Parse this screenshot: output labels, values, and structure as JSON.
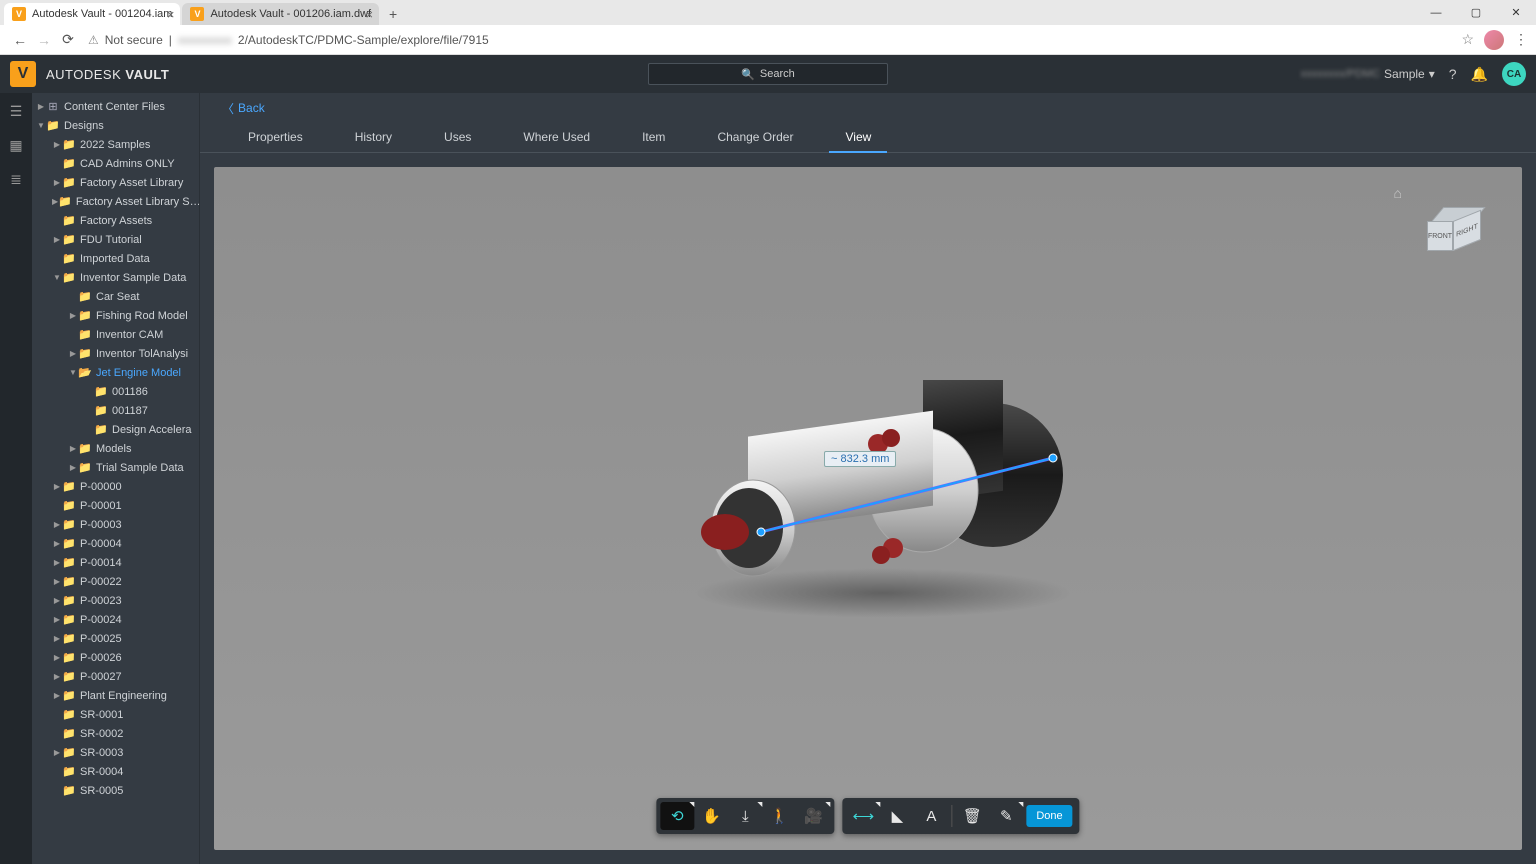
{
  "browser": {
    "tabs": [
      {
        "title": "Autodesk Vault - 001204.iam",
        "active": true
      },
      {
        "title": "Autodesk Vault - 001206.iam.dwf",
        "active": false
      }
    ],
    "url_prefix": "Not secure",
    "url_blur": "xxxxxxxxx",
    "url_rest": "2/AutodeskTC/PDMC-Sample/explore/file/7915"
  },
  "header": {
    "brand_pre": "AUTODESK",
    "brand_main": "VAULT",
    "search_placeholder": "Search",
    "project_label": "Sample",
    "project_prefix": "xxxxxxxx/PDMC",
    "user_initials": "CA"
  },
  "back_label": "Back",
  "tabs": [
    "Properties",
    "History",
    "Uses",
    "Where Used",
    "Item",
    "Change Order",
    "View"
  ],
  "active_tab": "View",
  "viewcube": {
    "front": "FRONT",
    "right": "RIGHT"
  },
  "measurement": "~ 832.3 mm",
  "toolbar1": [
    {
      "name": "orbit",
      "icon": "⟲",
      "active": true,
      "corner": true
    },
    {
      "name": "pan",
      "icon": "✋"
    },
    {
      "name": "zoom",
      "icon": "⤓",
      "corner": true
    },
    {
      "name": "walk",
      "icon": "🚶"
    },
    {
      "name": "camera",
      "icon": "🎥",
      "corner": true
    }
  ],
  "toolbar2": [
    {
      "name": "measure-distance",
      "icon": "⟷",
      "measure": true,
      "corner": true
    },
    {
      "name": "measure-angle",
      "icon": "◣"
    },
    {
      "name": "text",
      "icon": "A"
    },
    {
      "sep": true
    },
    {
      "name": "delete",
      "icon": "🗑"
    },
    {
      "name": "settings-tool",
      "icon": "✎",
      "corner": true
    }
  ],
  "done_label": "Done",
  "tree": [
    {
      "label": "Content Center Files",
      "depth": 0,
      "caret": "closed",
      "icon": "⊞"
    },
    {
      "label": "Designs",
      "depth": 0,
      "caret": "open",
      "icon": "📁"
    },
    {
      "label": "2022 Samples",
      "depth": 1,
      "caret": "closed",
      "icon": "📁"
    },
    {
      "label": "CAD Admins ONLY",
      "depth": 1,
      "caret": "none",
      "icon": "📁"
    },
    {
      "label": "Factory Asset Library",
      "depth": 1,
      "caret": "closed",
      "icon": "📁"
    },
    {
      "label": "Factory Asset Library S…",
      "depth": 1,
      "caret": "closed",
      "icon": "📁"
    },
    {
      "label": "Factory Assets",
      "depth": 1,
      "caret": "none",
      "icon": "📁"
    },
    {
      "label": "FDU Tutorial",
      "depth": 1,
      "caret": "closed",
      "icon": "📁"
    },
    {
      "label": "Imported Data",
      "depth": 1,
      "caret": "none",
      "icon": "📁"
    },
    {
      "label": "Inventor Sample Data",
      "depth": 1,
      "caret": "open",
      "icon": "📁"
    },
    {
      "label": "Car Seat",
      "depth": 2,
      "caret": "none",
      "icon": "📁"
    },
    {
      "label": "Fishing Rod Model",
      "depth": 2,
      "caret": "closed",
      "icon": "📁"
    },
    {
      "label": "Inventor CAM",
      "depth": 2,
      "caret": "none",
      "icon": "📁"
    },
    {
      "label": "Inventor TolAnalysi",
      "depth": 2,
      "caret": "closed",
      "icon": "📁"
    },
    {
      "label": "Jet Engine Model",
      "depth": 2,
      "caret": "open",
      "icon": "📂",
      "selected": true
    },
    {
      "label": "001186",
      "depth": 3,
      "caret": "none",
      "icon": "📁"
    },
    {
      "label": "001187",
      "depth": 3,
      "caret": "none",
      "icon": "📁"
    },
    {
      "label": "Design Accelera",
      "depth": 3,
      "caret": "none",
      "icon": "📁"
    },
    {
      "label": "Models",
      "depth": 2,
      "caret": "closed",
      "icon": "📁"
    },
    {
      "label": "Trial Sample Data",
      "depth": 2,
      "caret": "closed",
      "icon": "📁"
    },
    {
      "label": "P-00000",
      "depth": 1,
      "caret": "closed",
      "icon": "📁"
    },
    {
      "label": "P-00001",
      "depth": 1,
      "caret": "none",
      "icon": "📁"
    },
    {
      "label": "P-00003",
      "depth": 1,
      "caret": "closed",
      "icon": "📁"
    },
    {
      "label": "P-00004",
      "depth": 1,
      "caret": "closed",
      "icon": "📁"
    },
    {
      "label": "P-00014",
      "depth": 1,
      "caret": "closed",
      "icon": "📁"
    },
    {
      "label": "P-00022",
      "depth": 1,
      "caret": "closed",
      "icon": "📁"
    },
    {
      "label": "P-00023",
      "depth": 1,
      "caret": "closed",
      "icon": "📁"
    },
    {
      "label": "P-00024",
      "depth": 1,
      "caret": "closed",
      "icon": "📁"
    },
    {
      "label": "P-00025",
      "depth": 1,
      "caret": "closed",
      "icon": "📁"
    },
    {
      "label": "P-00026",
      "depth": 1,
      "caret": "closed",
      "icon": "📁"
    },
    {
      "label": "P-00027",
      "depth": 1,
      "caret": "closed",
      "icon": "📁"
    },
    {
      "label": "Plant Engineering",
      "depth": 1,
      "caret": "closed",
      "icon": "📁"
    },
    {
      "label": "SR-0001",
      "depth": 1,
      "caret": "none",
      "icon": "📁"
    },
    {
      "label": "SR-0002",
      "depth": 1,
      "caret": "none",
      "icon": "📁"
    },
    {
      "label": "SR-0003",
      "depth": 1,
      "caret": "closed",
      "icon": "📁"
    },
    {
      "label": "SR-0004",
      "depth": 1,
      "caret": "none",
      "icon": "📁"
    },
    {
      "label": "SR-0005",
      "depth": 1,
      "caret": "none",
      "icon": "📁"
    }
  ]
}
